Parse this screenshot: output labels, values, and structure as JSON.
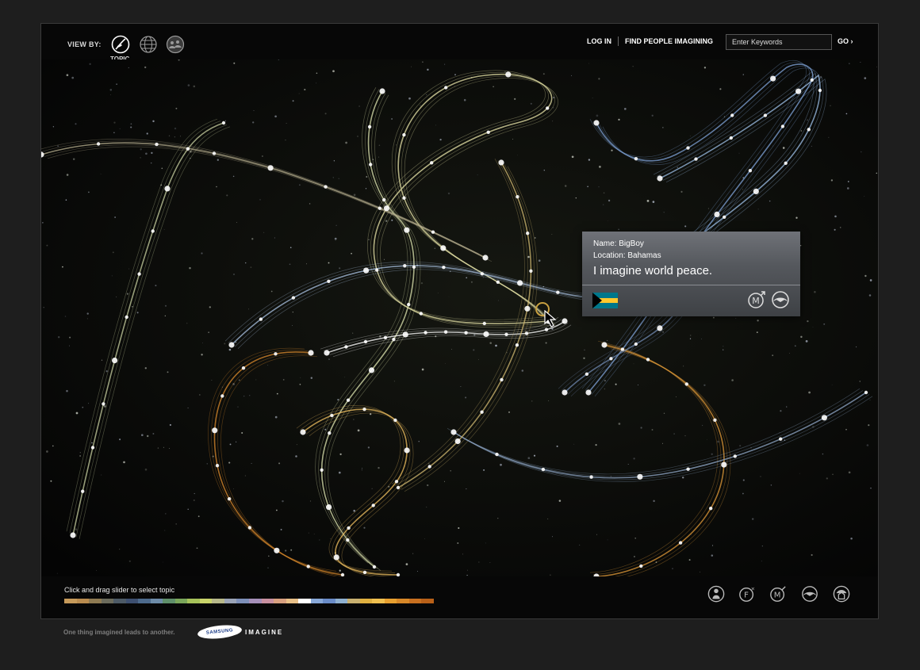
{
  "header": {
    "view_by_label": "VIEW BY:",
    "view_options": [
      {
        "icon": "topic-icon",
        "label": "TOPIC",
        "selected": true
      },
      {
        "icon": "globe-icon",
        "selected": false
      },
      {
        "icon": "people-icon",
        "selected": false
      }
    ],
    "login_label": "LOG IN",
    "find_people_label": "FIND PEOPLE IMAGINING",
    "search_placeholder": "Enter Keywords",
    "go_label": "GO ›"
  },
  "popup": {
    "name": "Name: BigBoy",
    "location": "Location: Bahamas",
    "message": "I imagine world peace.",
    "flag_icon": "bahamas-flag-icon",
    "action_icons": [
      "male-icon",
      "share-icon"
    ]
  },
  "bottom": {
    "slider_label": "Click and drag slider to select topic",
    "slider_colors": [
      "#c69a5a",
      "#b98b4f",
      "#8e7a52",
      "#6b6b5c",
      "#4d5a66",
      "#3d4f70",
      "#4d6a8c",
      "#6d8ba8",
      "#5f8f6a",
      "#7aa65a",
      "#a6c25a",
      "#c9d46a",
      "#b7b88a",
      "#9aa3b6",
      "#7d8fb8",
      "#a58fb8",
      "#c890a0",
      "#d8a080",
      "#e8c088",
      "#ffffff",
      "#88a8d8",
      "#6a8cc8",
      "#8fb0d0",
      "#c8b070",
      "#e0b040",
      "#f0c050",
      "#e8a030",
      "#d88828",
      "#c87020",
      "#b86018"
    ],
    "icons": [
      "person-icon",
      "female-icon",
      "male-icon",
      "share-icon",
      "home-icon"
    ]
  },
  "footer": {
    "tagline": "One thing imagined leads to another.",
    "brand": "SAMSUNG",
    "product": "IMAGINE"
  }
}
